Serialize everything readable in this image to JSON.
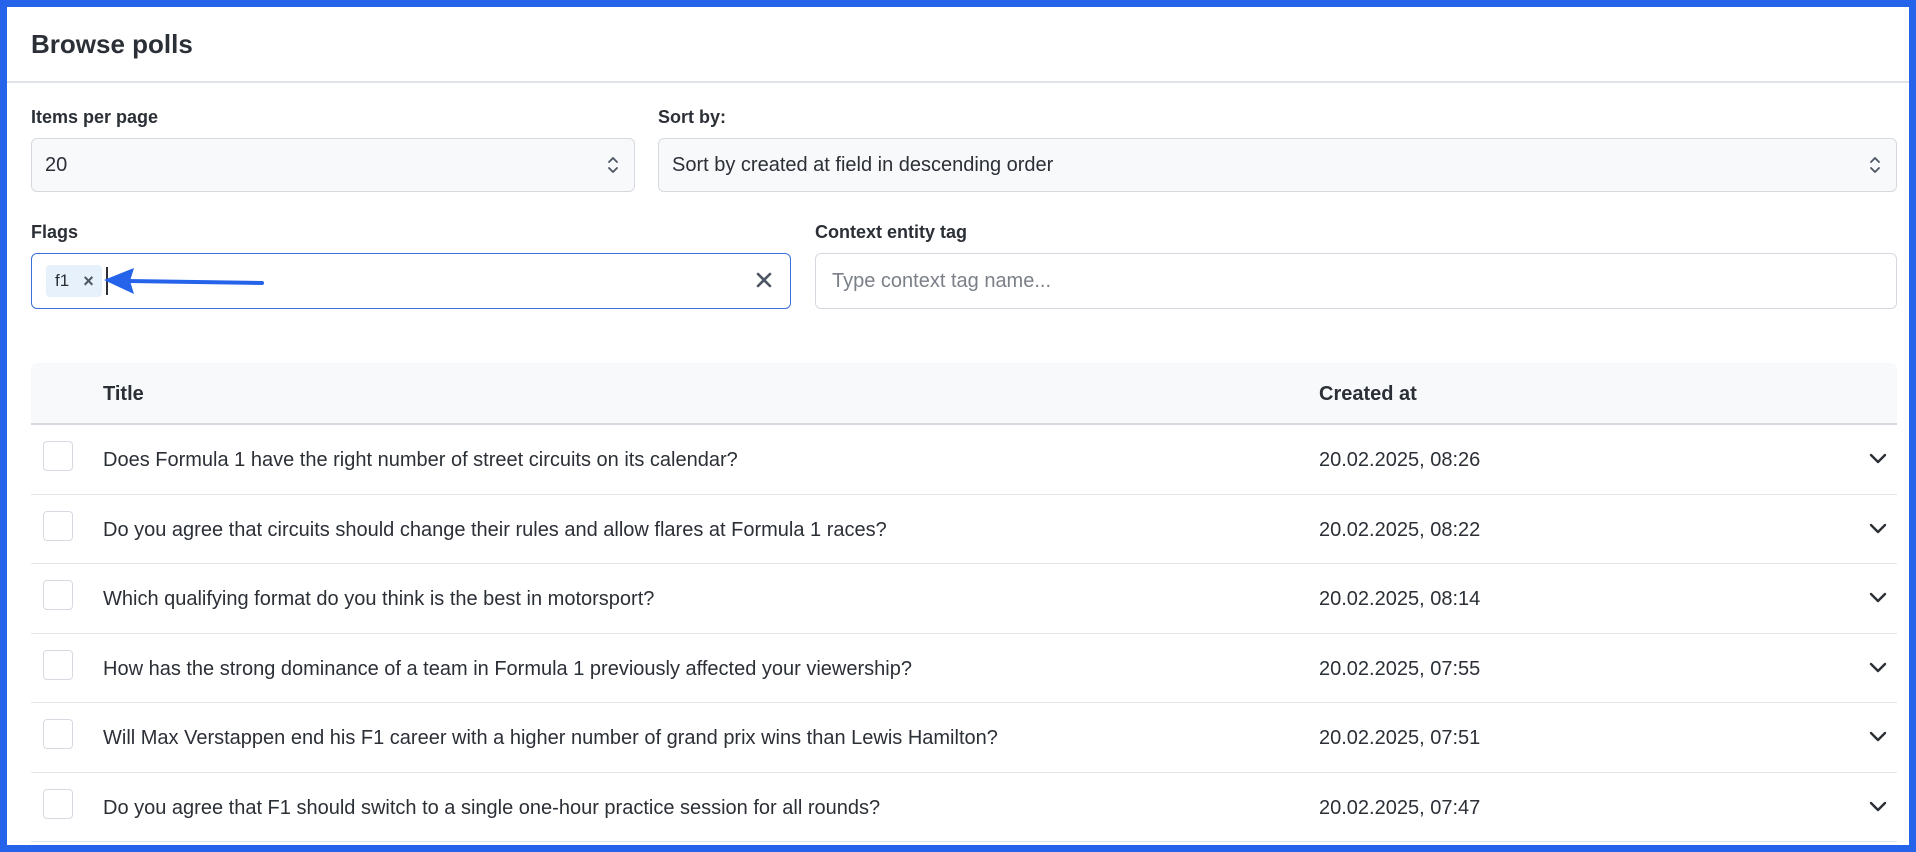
{
  "header": {
    "title": "Browse polls"
  },
  "filters": {
    "items_per_page": {
      "label": "Items per page",
      "value": "20"
    },
    "sort_by": {
      "label": "Sort by:",
      "value": "Sort by created at field in descending order"
    },
    "flags": {
      "label": "Flags",
      "chips": [
        {
          "label": "f1"
        }
      ]
    },
    "context_tag": {
      "label": "Context entity tag",
      "placeholder": "Type context tag name..."
    }
  },
  "table": {
    "columns": {
      "title": "Title",
      "created_at": "Created at"
    },
    "rows": [
      {
        "title": "Does Formula 1 have the right number of street circuits on its calendar?",
        "created_at": "20.02.2025, 08:26"
      },
      {
        "title": "Do you agree that circuits should change their rules and allow flares at Formula 1 races?",
        "created_at": "20.02.2025, 08:22"
      },
      {
        "title": "Which qualifying format do you think is the best in motorsport?",
        "created_at": "20.02.2025, 08:14"
      },
      {
        "title": "How has the strong dominance of a team in Formula 1 previously affected your viewership?",
        "created_at": "20.02.2025, 07:55"
      },
      {
        "title": "Will Max Verstappen end his F1 career with a higher number of grand prix wins than Lewis Hamilton?",
        "created_at": "20.02.2025, 07:51"
      },
      {
        "title": "Do you agree that F1 should switch to a single one-hour practice session for all rounds?",
        "created_at": "20.02.2025, 07:47"
      }
    ]
  },
  "icons": {
    "chip_remove": "close-icon",
    "clear": "close-icon",
    "select": "chevron-up-down-icon",
    "row_expand": "chevron-down-icon",
    "annotation": "arrow-left-icon"
  },
  "colors": {
    "accent": "#2563eb",
    "focus_border": "#3b6fd8",
    "chip_bg": "#e6f1fb"
  }
}
